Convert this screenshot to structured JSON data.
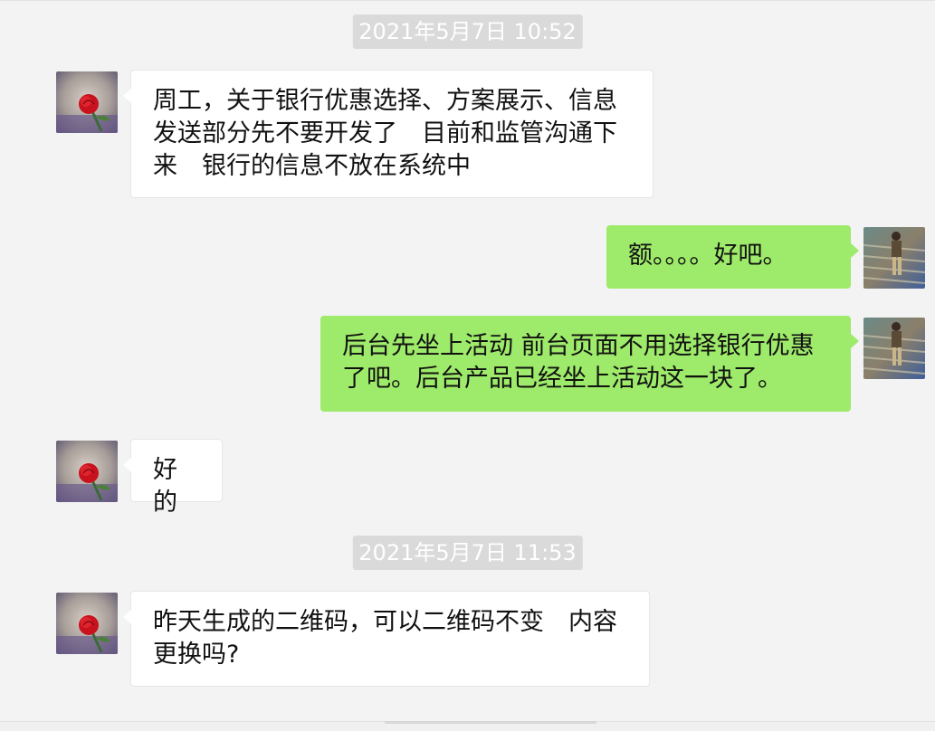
{
  "chat": {
    "timestamps": [
      "2021年5月7日 10:52",
      "2021年5月7日 11:53"
    ],
    "messages": [
      {
        "sender": "other",
        "text": "周工，关于银行优惠选择、方案展示、信息发送部分先不要开发了　目前和监管沟通下来　银行的信息不放在系统中"
      },
      {
        "sender": "me",
        "text": "额。。。。好吧。"
      },
      {
        "sender": "me",
        "text": "后台先坐上活动 前台页面不用选择银行优惠了吧。后台产品已经坐上活动这一块了。"
      },
      {
        "sender": "other",
        "text": "好的"
      },
      {
        "sender": "other",
        "text": "昨天生成的二维码，可以二维码不变　内容更换吗?"
      }
    ]
  },
  "colors": {
    "background": "#f3f3f3",
    "incoming_bubble": "#ffffff",
    "outgoing_bubble": "#9eea6a",
    "timestamp_bg": "#dadada"
  },
  "icons": {
    "other_avatar": "red-rose-avatar-icon",
    "my_avatar": "person-on-stairs-avatar-icon"
  }
}
